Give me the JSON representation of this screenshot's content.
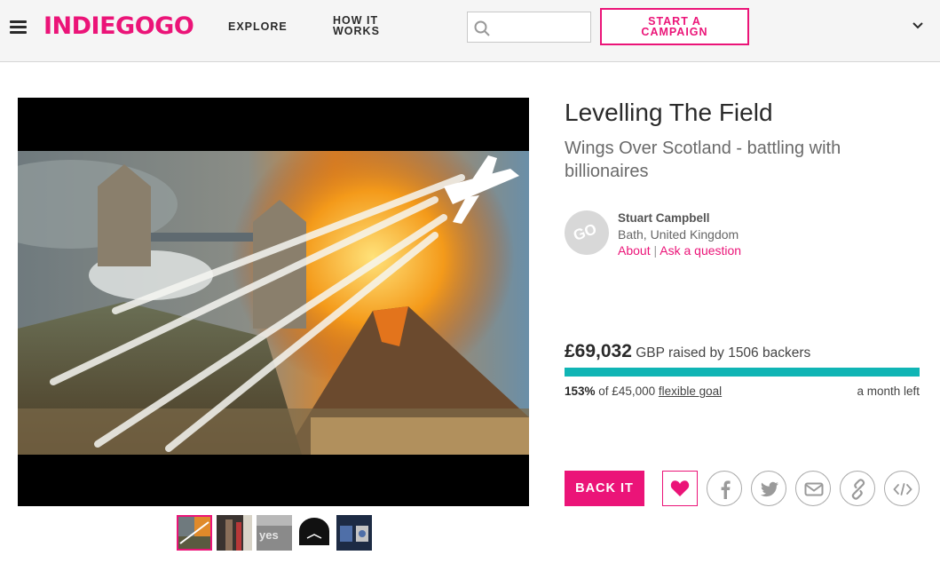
{
  "header": {
    "logo": "INDIEGOGO",
    "nav_explore": "EXPLORE",
    "nav_how_line1": "HOW IT",
    "nav_how_line2": "WORKS",
    "search_placeholder": "",
    "start_line1": "START A",
    "start_line2": "CAMPAIGN"
  },
  "campaign": {
    "title": "Levelling The Field",
    "subtitle": "Wings Over Scotland - battling with billionaires",
    "owner": {
      "avatar_text": "GO",
      "name": "Stuart Campbell",
      "location": "Bath, United Kingdom",
      "about_link": "About",
      "separator": "|",
      "ask_link": "Ask a question"
    },
    "funding": {
      "amount": "£69,032",
      "raised_text": "GBP raised by 1506 backers",
      "progress_fraction": 1.0,
      "percent": "153%",
      "of_goal": "of £45,000",
      "goal_type": "flexible goal",
      "time_left": "a month left"
    },
    "back_label": "BACK IT"
  },
  "media": {
    "thumbnails": [
      "thumb-bridge-volcano",
      "thumb-street",
      "thumb-yes",
      "thumb-dark-figure",
      "thumb-stamps"
    ],
    "selected_thumbnail": 0
  },
  "share_icons": [
    "facebook-icon",
    "twitter-icon",
    "email-icon",
    "link-icon",
    "embed-icon"
  ],
  "colors": {
    "brand": "#eb1478",
    "progress": "#10b5b5",
    "header_bg": "#f5f5f5"
  }
}
